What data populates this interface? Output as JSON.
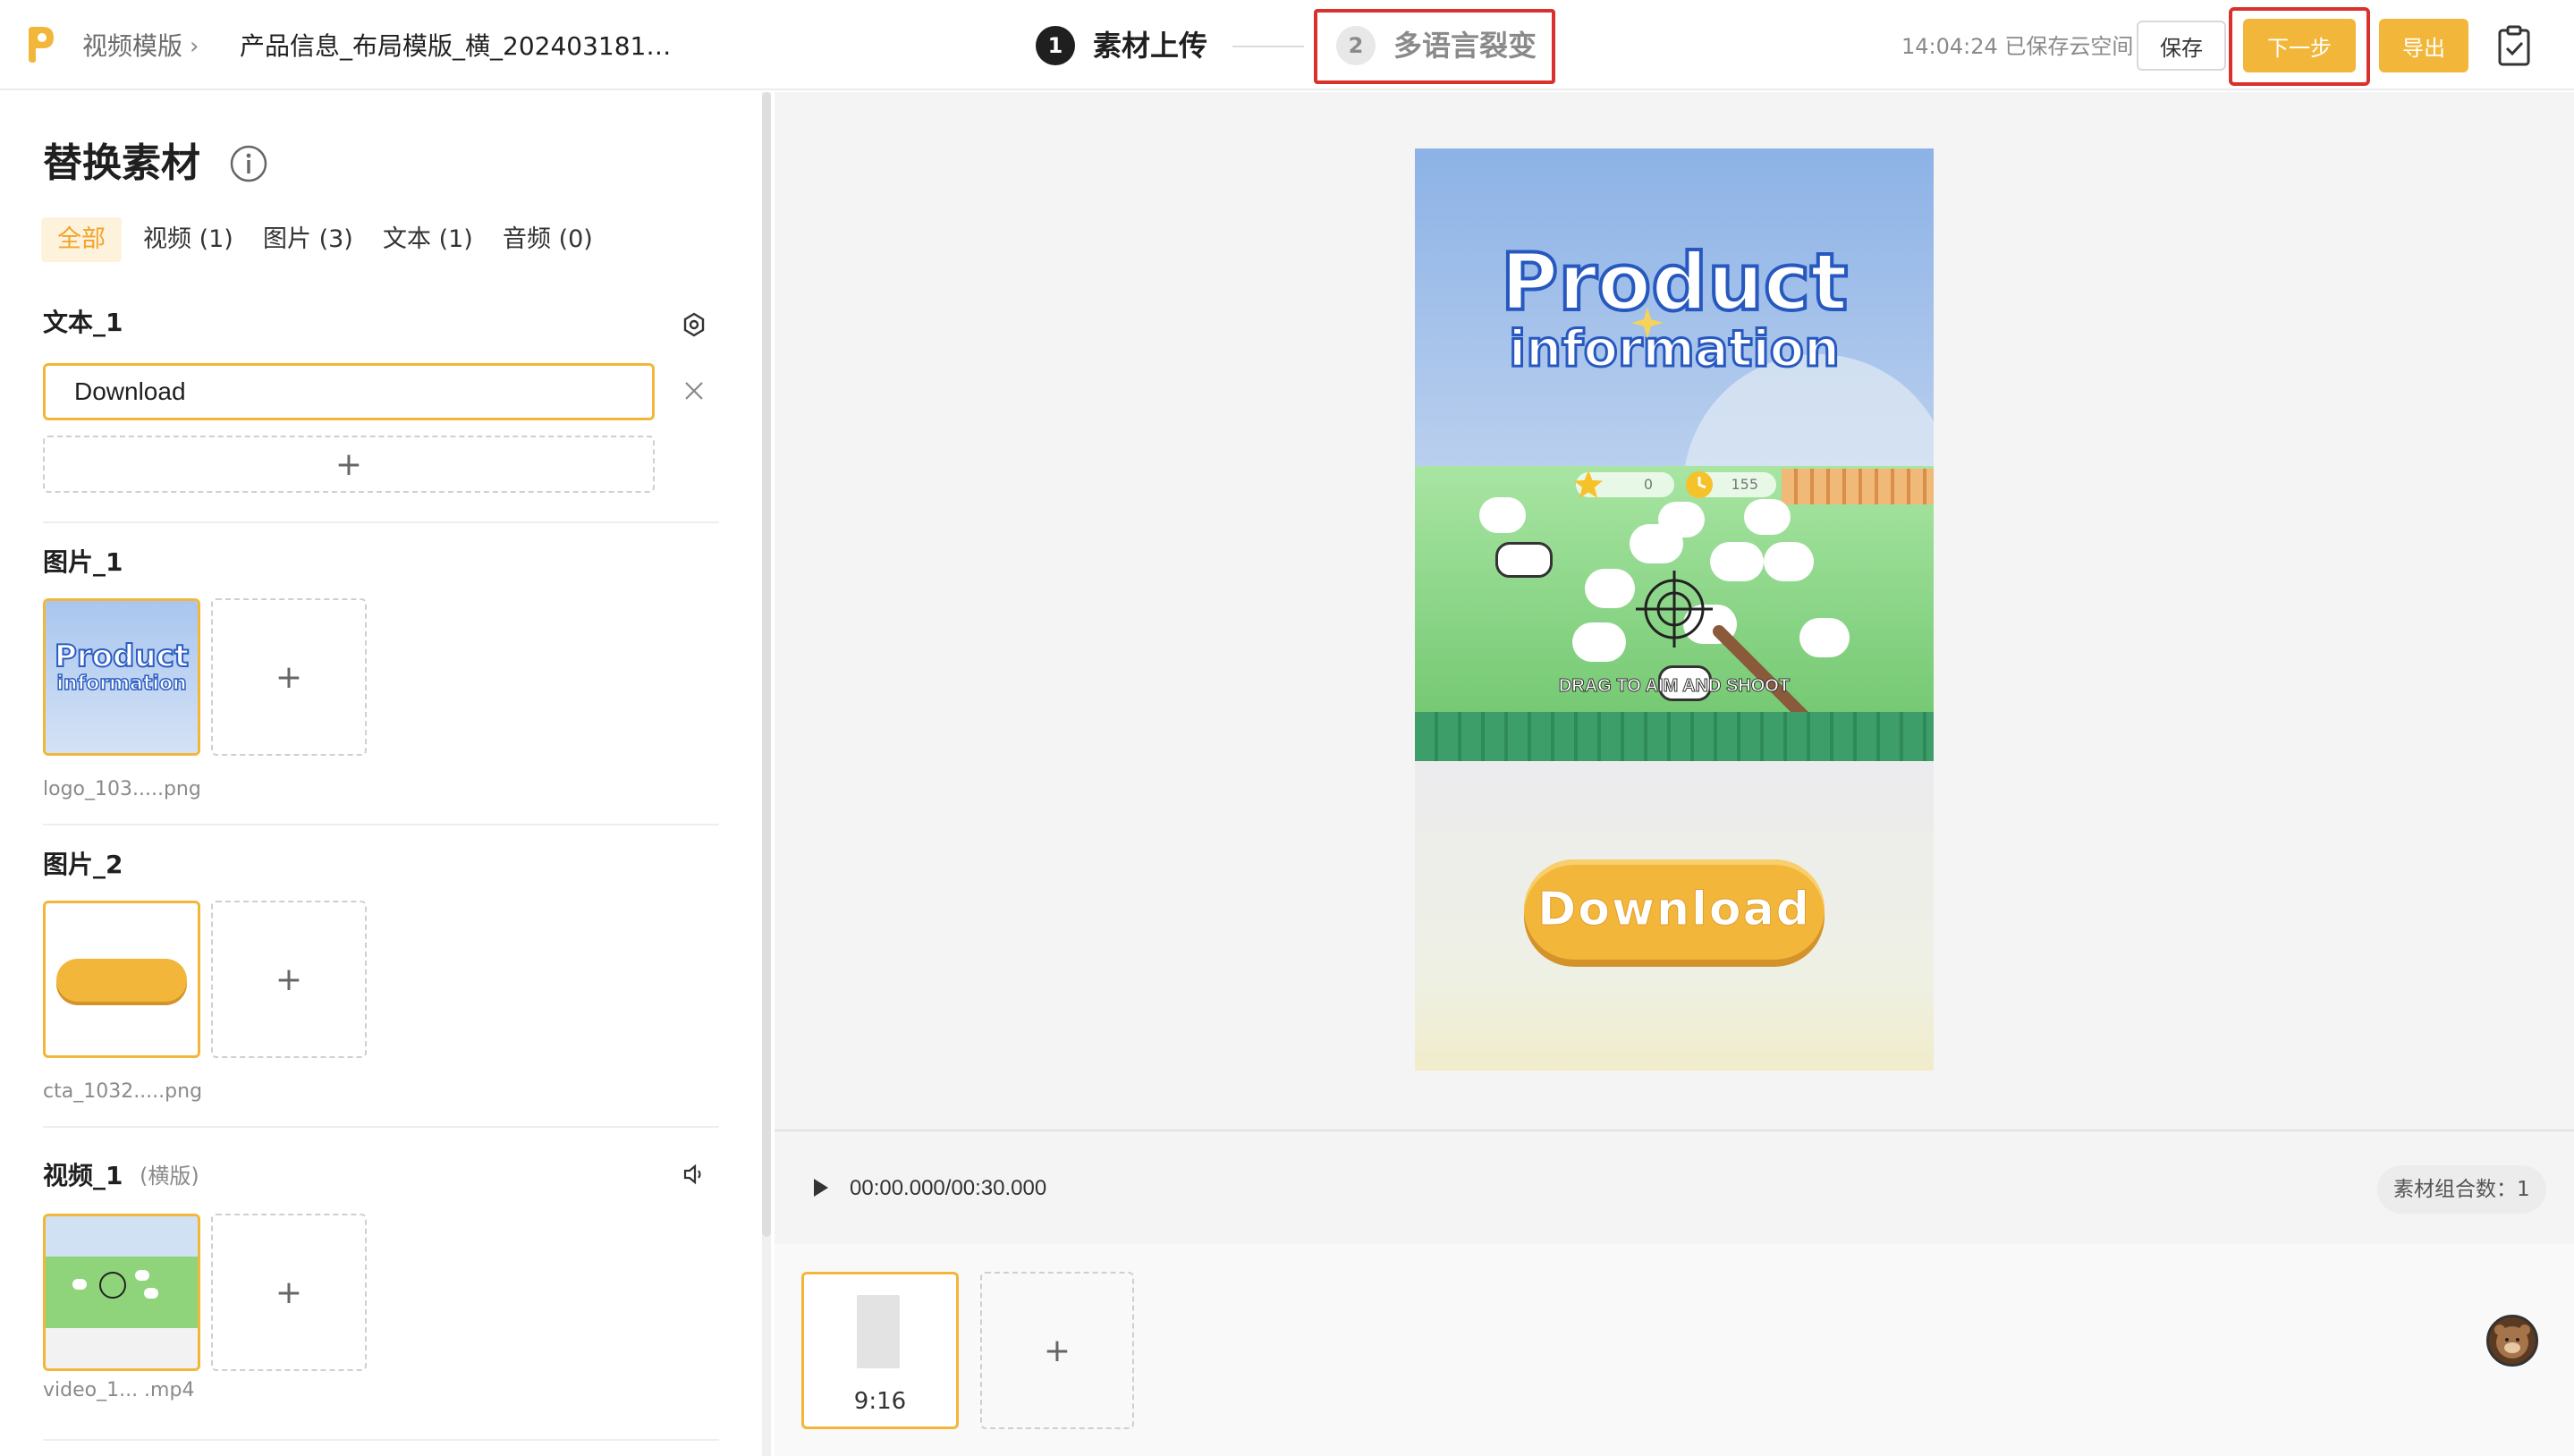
{
  "header": {
    "breadcrumb_root": "视频模版",
    "breadcrumb_sep": "›",
    "project_title": "产品信息_布局模版_横_2024031813...",
    "steps": [
      {
        "num": "1",
        "label": "素材上传",
        "state": "active"
      },
      {
        "num": "2",
        "label": "多语言裂变",
        "state": "inactive"
      }
    ],
    "save_status": "14:04:24 已保存云空间",
    "save_label": "保存",
    "next_label": "下一步",
    "export_label": "导出"
  },
  "panel": {
    "title": "替换素材",
    "tabs": [
      "全部",
      "视频 (1)",
      "图片 (3)",
      "文本 (1)",
      "音频 (0)"
    ],
    "active_tab": "全部",
    "sections": {
      "text_1": {
        "title": "文本_1",
        "value": "Download",
        "add_label": "+"
      },
      "image_1": {
        "title": "图片_1",
        "filename": "logo_103.....png",
        "thumb_text_1": "Product",
        "thumb_text_2": "information",
        "add_label": "+"
      },
      "image_2": {
        "title": "图片_2",
        "filename": "cta_1032.....png",
        "add_label": "+"
      },
      "video_1": {
        "title": "视频_1",
        "subtitle": "(横版)",
        "filename": "video_1... .mp4",
        "add_label": "+"
      }
    }
  },
  "preview": {
    "logo_line_1": "Product",
    "logo_line_2": "information",
    "game_hint": "DRAG TO AIM AND SHOOT",
    "hud_score": "0",
    "hud_timer": "155",
    "cta_label": "Download",
    "timecode": "00:00.000/00:30.000",
    "combo_count": "素材组合数：1",
    "ratio_label": "9:16",
    "ratio_add": "+"
  },
  "colors": {
    "accent": "#f2b73a",
    "highlight": "#d9312b",
    "sky": "#8fb6e8",
    "grass": "#79c96a"
  }
}
